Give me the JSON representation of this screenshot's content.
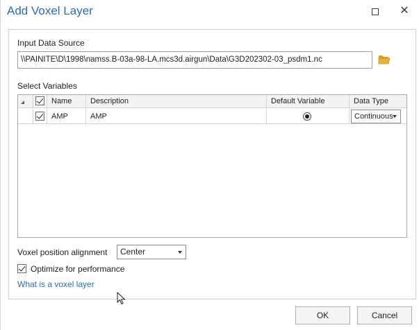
{
  "window": {
    "title": "Add Voxel Layer"
  },
  "source": {
    "label": "Input Data Source",
    "value": "\\\\PAINITE\\D\\1998\\namss.B-03a-98-LA.mcs3d.airgun\\Data\\G3D202302-03_psdm1.nc",
    "browse_icon": "folder-open-icon"
  },
  "variables": {
    "label": "Select Variables",
    "columns": [
      "Name",
      "Description",
      "Default Variable",
      "Data Type"
    ],
    "rows": [
      {
        "checked": true,
        "name": "AMP",
        "description": "AMP",
        "default": true,
        "data_type": "Continuous"
      }
    ]
  },
  "alignment": {
    "label": "Voxel position alignment",
    "value": "Center"
  },
  "optimize": {
    "label": "Optimize for performance",
    "checked": true
  },
  "help_link": "What is a voxel layer",
  "buttons": {
    "ok": "OK",
    "cancel": "Cancel"
  },
  "colors": {
    "accent": "#2a6ebb",
    "folder": "#e8b23a"
  }
}
